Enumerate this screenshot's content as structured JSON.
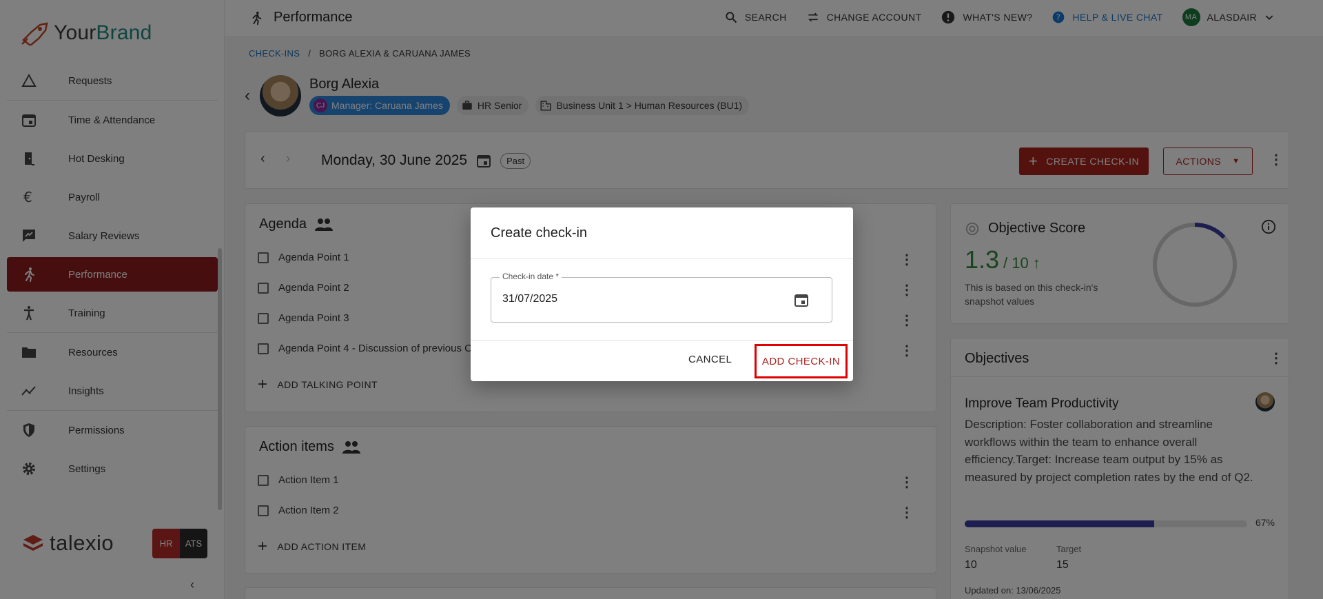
{
  "brand": {
    "part1": "Your",
    "part2": "Brand"
  },
  "sidebar": {
    "items": [
      {
        "label": "Requests",
        "icon": "triangle-icon"
      },
      {
        "label": "Time & Attendance",
        "icon": "calendar-icon"
      },
      {
        "label": "Hot Desking",
        "icon": "door-icon"
      },
      {
        "label": "Payroll",
        "icon": "euro-icon"
      },
      {
        "label": "Salary Reviews",
        "icon": "rate-review-icon"
      },
      {
        "label": "Performance",
        "icon": "runner-icon",
        "active": true
      },
      {
        "label": "Training",
        "icon": "person-training-icon"
      },
      {
        "label": "Resources",
        "icon": "folder-icon"
      },
      {
        "label": "Insights",
        "icon": "trend-icon"
      },
      {
        "label": "Permissions",
        "icon": "shield-icon"
      },
      {
        "label": "Settings",
        "icon": "gear-icon"
      }
    ],
    "footer_brand": "talexio",
    "switch_hr": "HR",
    "switch_ats": "ATS",
    "collapse": "‹"
  },
  "topbar": {
    "title": "Performance",
    "search": "SEARCH",
    "change_account": "CHANGE ACCOUNT",
    "whats_new": "WHAT'S NEW?",
    "help": "HELP & LIVE CHAT",
    "user_initials": "MA",
    "user_name": "ALASDAIR"
  },
  "breadcrumb": {
    "link": "CHECK-INS",
    "sep": "/",
    "current": "BORG ALEXIA & CARUANA JAMES"
  },
  "person": {
    "name": "Borg Alexia",
    "manager_initials": "CJ",
    "manager": "Manager: Caruana James",
    "role": "HR Senior",
    "unit": "Business Unit 1 > Human Resources (BU1)"
  },
  "datebar": {
    "date": "Monday, 30 June 2025",
    "status": "Past",
    "create_button": "CREATE CHECK-IN",
    "actions_button": "ACTIONS"
  },
  "agenda": {
    "title": "Agenda",
    "items": [
      "Agenda Point 1",
      "Agenda Point 2",
      "Agenda Point 3",
      "Agenda Point 4 - Discussion of previous C"
    ],
    "add": "ADD TALKING POINT"
  },
  "action_items": {
    "title": "Action items",
    "items": [
      "Action Item 1",
      "Action Item 2"
    ],
    "add": "ADD ACTION ITEM"
  },
  "objective_score": {
    "title": "Objective Score",
    "value": "1.3",
    "max": "/ 10",
    "arrow": "↑",
    "description": "This is based on this check-in's snapshot values",
    "fraction": 0.13,
    "colors": {
      "good": "#2e8b3a",
      "gauge": "#3b3aa0"
    }
  },
  "objectives": {
    "title": "Objectives",
    "name": "Improve Team Productivity",
    "description": "Description: Foster collaboration and streamline workflows within the team to enhance overall efficiency.Target: Increase team output by 15% as measured by project completion rates by the end of Q2.",
    "progress": 0.67,
    "progress_label": "67%",
    "snapshot_label": "Snapshot value",
    "snapshot_value": "10",
    "target_label": "Target",
    "target_value": "15",
    "updated": "Updated on: 13/06/2025"
  },
  "dialog": {
    "title": "Create check-in",
    "field_label": "Check-in date *",
    "field_value": "31/07/2025",
    "cancel": "CANCEL",
    "add": "ADD CHECK-IN"
  },
  "colors": {
    "accent": "#a8241f",
    "active_nav": "#8c1c1c",
    "link": "#1f6fb5",
    "highlight": "#e00000"
  }
}
